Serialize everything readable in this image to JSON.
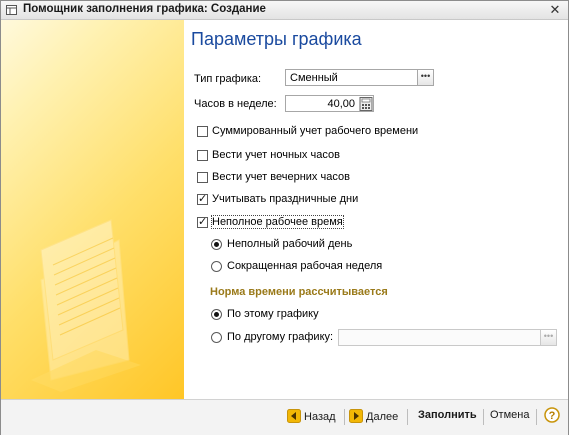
{
  "window": {
    "title": "Помощник заполнения графика: Создание",
    "close_glyph": "✕"
  },
  "page": {
    "heading": "Параметры графика"
  },
  "form": {
    "schedule_type": {
      "label": "Тип графика:",
      "value": "Сменный"
    },
    "hours_per_week": {
      "label": "Часов в неделе:",
      "value": "40,00"
    },
    "checkboxes": [
      {
        "label": "Суммированный учет рабочего времени",
        "checked": false
      },
      {
        "label": "Вести учет ночных часов",
        "checked": false
      },
      {
        "label": "Вести учет вечерних часов",
        "checked": false
      },
      {
        "label": "Учитывать праздничные дни",
        "checked": true
      },
      {
        "label": "Неполное рабочее время",
        "checked": true
      }
    ],
    "parttime_options": [
      {
        "label": "Неполный рабочий день",
        "selected": true
      },
      {
        "label": "Сокращенная рабочая неделя",
        "selected": false
      }
    ],
    "norm_section": {
      "title": "Норма времени рассчитывается",
      "options": [
        {
          "label": "По этому графику",
          "selected": true
        },
        {
          "label": "По другому графику:",
          "selected": false
        }
      ],
      "other_schedule_value": ""
    }
  },
  "footer": {
    "back_label": "Назад",
    "next_label": "Далее",
    "fill_label": "Заполнить",
    "cancel_label": "Отмена",
    "help_glyph": "?"
  },
  "colors": {
    "heading": "#1a4a9f",
    "section_title": "#9a7a1a",
    "nav_arrow": "#f2b705"
  }
}
